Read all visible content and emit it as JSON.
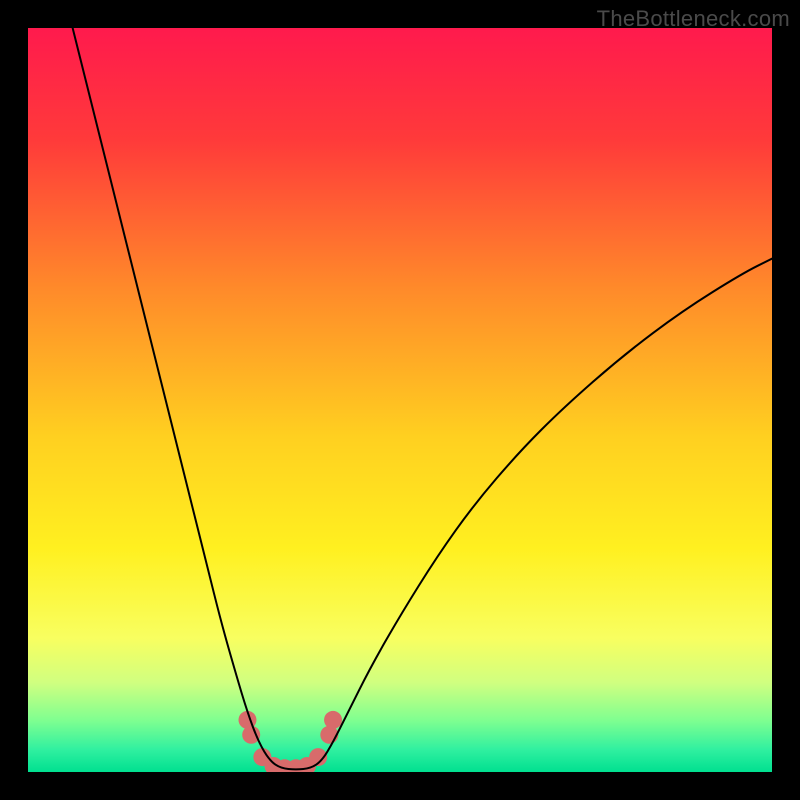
{
  "watermark": "TheBottleneck.com",
  "chart_data": {
    "type": "line",
    "title": "",
    "xlabel": "",
    "ylabel": "",
    "xlim": [
      0,
      100
    ],
    "ylim": [
      0,
      100
    ],
    "background_gradient": {
      "stops": [
        {
          "offset": 0.0,
          "color": "#ff1a4d"
        },
        {
          "offset": 0.15,
          "color": "#ff3a3a"
        },
        {
          "offset": 0.35,
          "color": "#ff8a2a"
        },
        {
          "offset": 0.55,
          "color": "#ffd020"
        },
        {
          "offset": 0.7,
          "color": "#fff020"
        },
        {
          "offset": 0.82,
          "color": "#f8ff60"
        },
        {
          "offset": 0.88,
          "color": "#d0ff80"
        },
        {
          "offset": 0.93,
          "color": "#80ff90"
        },
        {
          "offset": 0.97,
          "color": "#30f0a0"
        },
        {
          "offset": 1.0,
          "color": "#00e090"
        }
      ]
    },
    "series": [
      {
        "name": "bottleneck-curve",
        "color": "#000000",
        "stroke_width": 2,
        "points": [
          {
            "x": 6.0,
            "y": 100.0
          },
          {
            "x": 8.0,
            "y": 92.0
          },
          {
            "x": 10.0,
            "y": 84.0
          },
          {
            "x": 12.0,
            "y": 76.0
          },
          {
            "x": 14.0,
            "y": 68.0
          },
          {
            "x": 16.0,
            "y": 60.0
          },
          {
            "x": 18.0,
            "y": 52.0
          },
          {
            "x": 20.0,
            "y": 44.0
          },
          {
            "x": 22.0,
            "y": 36.0
          },
          {
            "x": 24.0,
            "y": 28.0
          },
          {
            "x": 26.0,
            "y": 20.0
          },
          {
            "x": 28.0,
            "y": 13.0
          },
          {
            "x": 29.5,
            "y": 8.0
          },
          {
            "x": 31.0,
            "y": 4.0
          },
          {
            "x": 32.5,
            "y": 1.5
          },
          {
            "x": 34.0,
            "y": 0.5
          },
          {
            "x": 36.0,
            "y": 0.3
          },
          {
            "x": 38.0,
            "y": 0.5
          },
          {
            "x": 39.5,
            "y": 1.5
          },
          {
            "x": 41.0,
            "y": 4.0
          },
          {
            "x": 43.0,
            "y": 8.0
          },
          {
            "x": 46.0,
            "y": 14.0
          },
          {
            "x": 50.0,
            "y": 21.0
          },
          {
            "x": 55.0,
            "y": 29.0
          },
          {
            "x": 60.0,
            "y": 36.0
          },
          {
            "x": 66.0,
            "y": 43.0
          },
          {
            "x": 72.0,
            "y": 49.0
          },
          {
            "x": 80.0,
            "y": 56.0
          },
          {
            "x": 88.0,
            "y": 62.0
          },
          {
            "x": 96.0,
            "y": 67.0
          },
          {
            "x": 100.0,
            "y": 69.0
          }
        ]
      }
    ],
    "markers": {
      "name": "bottom-markers",
      "color": "#d86b6b",
      "points": [
        {
          "x": 29.5,
          "y": 7.0
        },
        {
          "x": 30.0,
          "y": 5.0
        },
        {
          "x": 31.5,
          "y": 2.0
        },
        {
          "x": 33.0,
          "y": 0.8
        },
        {
          "x": 34.5,
          "y": 0.5
        },
        {
          "x": 36.0,
          "y": 0.5
        },
        {
          "x": 37.5,
          "y": 0.8
        },
        {
          "x": 39.0,
          "y": 2.0
        },
        {
          "x": 40.5,
          "y": 5.0
        },
        {
          "x": 41.0,
          "y": 7.0
        }
      ],
      "radius": 9
    }
  }
}
